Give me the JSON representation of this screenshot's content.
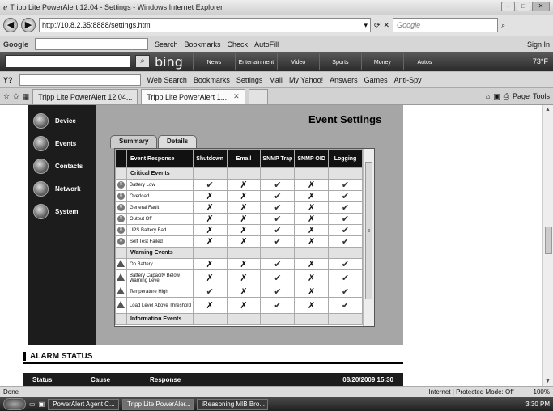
{
  "window": {
    "title": "Tripp Lite PowerAlert 12.04 - Settings - Windows Internet Explorer"
  },
  "address": {
    "url": "http://10.8.2.35:8888/settings.htm",
    "search_placeholder": "Google"
  },
  "google_bar": {
    "logo": "Google",
    "search": "Search",
    "bookmarks": "Bookmarks",
    "check": "Check",
    "autofill": "AutoFill",
    "sign_in": "Sign In"
  },
  "bing_bar": {
    "logo": "bing",
    "nav": [
      "News",
      "Entertainment",
      "Video",
      "Sports",
      "Money",
      "Autos"
    ],
    "weather": "73°F"
  },
  "yahoo_bar": {
    "logo": "Y?",
    "web_search": "Web Search",
    "bookmarks": "Bookmarks",
    "settings": "Settings",
    "mail": "Mail",
    "my_yahoo": "My Yahoo!",
    "answers": "Answers",
    "games": "Games",
    "antispy": "Anti-Spy"
  },
  "browser_tabs": [
    {
      "label": "Tripp Lite PowerAlert 12.04..."
    },
    {
      "label": "Tripp Lite PowerAlert 1..."
    }
  ],
  "cmd": {
    "page": "Page",
    "tools": "Tools"
  },
  "sidebar": {
    "items": [
      {
        "label": "Device"
      },
      {
        "label": "Events"
      },
      {
        "label": "Contacts"
      },
      {
        "label": "Network"
      },
      {
        "label": "System"
      }
    ]
  },
  "page": {
    "title": "Event Settings",
    "tabs": [
      "Summary",
      "Details"
    ]
  },
  "events": {
    "headers": [
      "Event Response",
      "Shutdown",
      "Email",
      "SNMP Trap",
      "SNMP OID",
      "Logging"
    ],
    "categories": [
      "Critical Events",
      "Warning Events",
      "Information Events"
    ],
    "critical": [
      {
        "name": "Battery Low",
        "cells": [
          "✔",
          "✗",
          "✔",
          "✗",
          "✔"
        ]
      },
      {
        "name": "Overload",
        "cells": [
          "✗",
          "✗",
          "✔",
          "✗",
          "✔"
        ]
      },
      {
        "name": "General Fault",
        "cells": [
          "✗",
          "✗",
          "✔",
          "✗",
          "✔"
        ]
      },
      {
        "name": "Output Off",
        "cells": [
          "✗",
          "✗",
          "✔",
          "✗",
          "✔"
        ]
      },
      {
        "name": "UPS Battery Bad",
        "cells": [
          "✗",
          "✗",
          "✔",
          "✗",
          "✔"
        ]
      },
      {
        "name": "Self Test Failed",
        "cells": [
          "✗",
          "✗",
          "✔",
          "✗",
          "✔"
        ]
      }
    ],
    "warning": [
      {
        "name": "On Battery",
        "cells": [
          "✗",
          "✗",
          "✔",
          "✗",
          "✔"
        ]
      },
      {
        "name": "Battery Capacity Below Warning Level",
        "cells": [
          "✗",
          "✗",
          "✔",
          "✗",
          "✔"
        ]
      },
      {
        "name": "Temperature High",
        "cells": [
          "✔",
          "✗",
          "✔",
          "✗",
          "✔"
        ]
      },
      {
        "name": "Load Level Above Threshold",
        "cells": [
          "✗",
          "✗",
          "✔",
          "✗",
          "✔"
        ]
      }
    ]
  },
  "alarm": {
    "title": "ALARM STATUS",
    "cols": [
      "Status",
      "Cause",
      "Response"
    ],
    "timestamp": "08/20/2009 15:30"
  },
  "statusbar": {
    "left": "Done",
    "zone": "Internet | Protected Mode: Off",
    "zoom": "100%"
  },
  "taskbar": {
    "items": [
      "PowerAlert Agent C...",
      "Tripp Lite PowerAler...",
      "iReasoning MIB Bro..."
    ],
    "time": "3:30 PM"
  }
}
